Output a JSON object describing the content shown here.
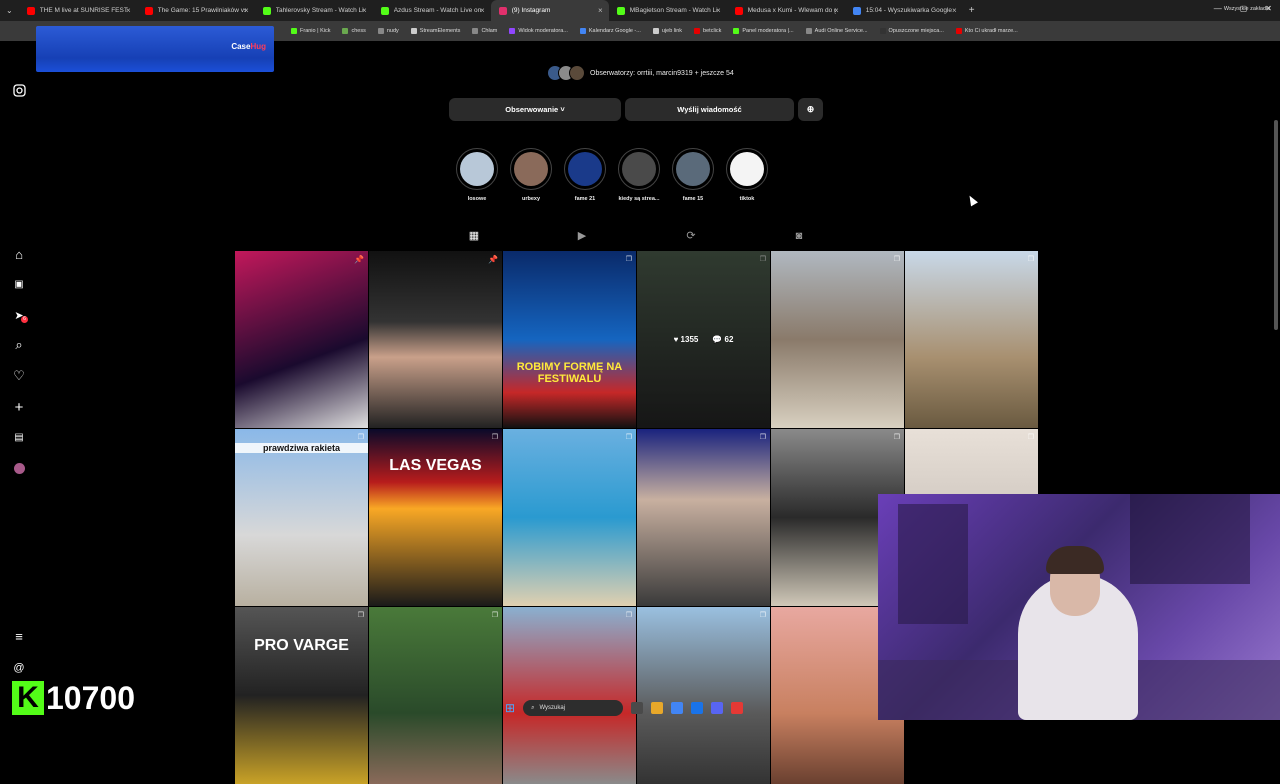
{
  "browser": {
    "tabs": [
      {
        "title": "THE M live at SUNRISE FESTIVAL",
        "color": "#ff0000"
      },
      {
        "title": "The Game: 15 Prawilniaków vs",
        "color": "#ff0000"
      },
      {
        "title": "Tahlerovsky Stream - Watch Live",
        "color": "#53fc18"
      },
      {
        "title": "Azdus Stream - Watch Live on",
        "color": "#53fc18"
      },
      {
        "title": "(9) Instagram",
        "color": "#e1306c",
        "active": true
      },
      {
        "title": "MBagietson Stream - Watch Li",
        "color": "#53fc18"
      },
      {
        "title": "Medusa x Kumi - Wlewam do g",
        "color": "#ff0000"
      },
      {
        "title": "15:04 - Wyszukiwarka Google",
        "color": "#4285f4"
      }
    ],
    "tab_close": "×",
    "new_tab": "+",
    "window_controls": [
      "—",
      "▢",
      "✕"
    ],
    "bookmarks": [
      {
        "label": "Franio | Kick",
        "color": "#53fc18"
      },
      {
        "label": "chess",
        "color": "#6aa84f"
      },
      {
        "label": "nudy",
        "color": "#888888"
      },
      {
        "label": "StreamElements",
        "color": "#cccccc"
      },
      {
        "label": "Chłam",
        "color": "#888888"
      },
      {
        "label": "Widok moderatora...",
        "color": "#9146ff"
      },
      {
        "label": "Kalendarz Google -...",
        "color": "#4285f4"
      },
      {
        "label": "ujeb link",
        "color": "#cccccc"
      },
      {
        "label": "betclick",
        "color": "#e60000"
      },
      {
        "label": "Panel moderatora |...",
        "color": "#53fc18"
      },
      {
        "label": "Audi Online Service...",
        "color": "#888888"
      },
      {
        "label": "Opuszczone miejsca...",
        "color": "#333333"
      },
      {
        "label": "Kto Ci ukradł marze...",
        "color": "#e60000"
      }
    ],
    "bookmarks_all": "Wszystkie zakładki"
  },
  "overlay_ad": {
    "brand_a": "Case",
    "brand_b": "Hug"
  },
  "sidebar_icons": [
    "instagram-icon",
    "home-icon",
    "reels-icon",
    "messages-icon",
    "search-icon",
    "notifications-icon",
    "create-icon",
    "dashboard-icon",
    "profile-icon",
    "menu-icon",
    "threads-icon"
  ],
  "sidebar_badge": "6",
  "profile": {
    "watchers_text": "Obserwatorzy: orrtiii, marcin9319 + jeszcze 54",
    "follow_button": "Obserwowanie ˅",
    "message_button": "Wyślij wiadomość",
    "add_user_glyph": "⊕"
  },
  "highlights": [
    {
      "label": "losowe",
      "color": "#b8c8d8"
    },
    {
      "label": "urbexy",
      "color": "#8a6a5a"
    },
    {
      "label": "fame 21",
      "color": "#1a3a8a"
    },
    {
      "label": "kiedy są strea...",
      "color": "#4a4a4a"
    },
    {
      "label": "fame 15",
      "color": "#5a6a7a"
    },
    {
      "label": "tiktok",
      "color": "#f4f4f4"
    }
  ],
  "profile_tabs": [
    {
      "name": "posts",
      "glyph": "▦"
    },
    {
      "name": "reels",
      "glyph": "▶"
    },
    {
      "name": "reposts",
      "glyph": "⟳"
    },
    {
      "name": "tagged",
      "glyph": "◙"
    }
  ],
  "posts": [
    {
      "bg": "linear-gradient(160deg,#c2185b,#1a0a2e 60%,#e0e0e0)",
      "caption": "",
      "pinned": true
    },
    {
      "bg": "linear-gradient(180deg,#111,#333 40%,#c9a08a 60%,#222)",
      "caption": "",
      "pinned": true
    },
    {
      "bg": "linear-gradient(180deg,#0a2a6a,#1565c0 50%,#c62828 80%,#111)",
      "caption": "ROBIMY FORMĘ NA FESTIWALU",
      "pinned": false
    },
    {
      "bg": "linear-gradient(180deg,#4a5a4a,#222)",
      "caption": "",
      "pinned": false,
      "likes": "1355",
      "comments": "62"
    },
    {
      "bg": "linear-gradient(180deg,#b0b8c0,#8a7a6a 50%,#d8d0c0)",
      "caption": "",
      "pinned": false
    },
    {
      "bg": "linear-gradient(180deg,#c8d8e8,#a89070 60%,#6a5a40)",
      "caption": "",
      "pinned": false
    },
    {
      "bg": "linear-gradient(180deg,#8ab8e8,#d8d8d8 60%,#b8b0a0)",
      "caption": "prawdziwa rakieta",
      "pinned": false
    },
    {
      "bg": "linear-gradient(180deg,#0a0a2a,#b71c1c 30%,#f9a825 45%,#1a1a1a)",
      "caption": "LAS VEGAS",
      "pinned": false
    },
    {
      "bg": "linear-gradient(180deg,#6ab0e0,#2a9ad0 50%,#e0d0b0)",
      "caption": "",
      "pinned": false
    },
    {
      "bg": "linear-gradient(180deg,#1a237e,#c8b0a0 40%,#3a3a3a)",
      "caption": "",
      "pinned": false
    },
    {
      "bg": "linear-gradient(180deg,#8a8a8a,#2a2a2a 50%,#d0c8b8)",
      "caption": "",
      "pinned": false
    },
    {
      "bg": "linear-gradient(180deg,#e8e0d8,#b8b0a8)",
      "caption": "",
      "pinned": false
    },
    {
      "bg": "linear-gradient(180deg,#555,#222 50%,#c9a227)",
      "caption": "PRO VARGE",
      "pinned": false
    },
    {
      "bg": "linear-gradient(180deg,#4a7a3a,#2a4a2a 60%,#8a6a5a)",
      "caption": "",
      "pinned": false
    },
    {
      "bg": "linear-gradient(180deg,#8ab0d0,#c62828 60%,#8a8a8a)",
      "caption": "",
      "pinned": false
    },
    {
      "bg": "linear-gradient(180deg,#9ac0e0,#5a5a5a 60%,#333)",
      "caption": "",
      "pinned": false
    },
    {
      "bg": "linear-gradient(180deg,#e8a8a0,#c88060 60%,#6a4030)",
      "caption": "",
      "pinned": false
    },
    {
      "bg": "#000000",
      "caption": "",
      "pinned": false
    }
  ],
  "kick_overlay": {
    "logo": "K",
    "count": "10700"
  },
  "taskbar": {
    "search_placeholder": "Wyszukaj",
    "start_glyph": "⊞",
    "icons": [
      "#4a4a4a",
      "#e8a82a",
      "#4285f4",
      "#1a73e8",
      "#5865f2",
      "#e53935"
    ]
  }
}
